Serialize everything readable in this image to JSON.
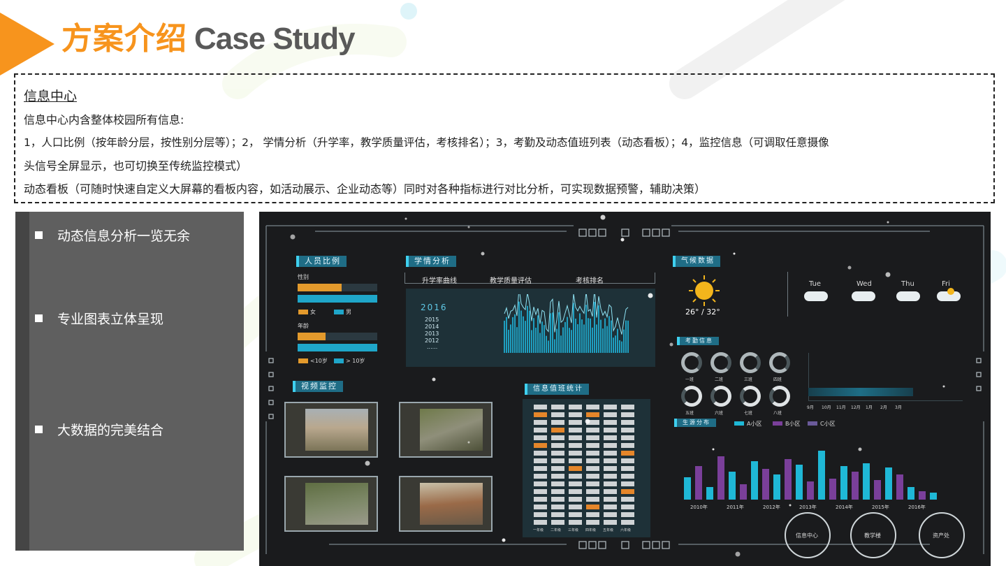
{
  "title": {
    "cn": "方案介绍",
    "en": "Case Study"
  },
  "info": {
    "heading": "信息中心",
    "line1": "信息中心内含整体校园所有信息:",
    "line2": "1，人口比例（按年龄分层，按性别分层等）；2， 学情分析（升学率，教学质量评估，考核排名）；3，考勤及动态值班列表（动态看板）；4，监控信息（可调取任意摄像",
    "line3": "头信号全屏显示，也可切换至传统监控模式）",
    "line4": "动态看板（可随时快速自定义大屏幕的看板内容，如活动展示、企业动态等）同时对各种指标进行对比分析，可实现数据预警，辅助决策）"
  },
  "features": [
    "动态信息分析一览无余",
    "专业图表立体呈现",
    "大数据的完美结合"
  ],
  "dashboard": {
    "people": {
      "title": "人员比例",
      "gender_label": "性别",
      "female": "女",
      "male": "男",
      "age_label": "年龄",
      "young": "<10岁",
      "old": "> 10岁"
    },
    "study": {
      "title": "学情分析",
      "tabs": [
        "升学率曲线",
        "教学质量评估",
        "考核排名"
      ],
      "current_year": "2016",
      "years": [
        "2015",
        "2014",
        "2013",
        "2012",
        "......"
      ]
    },
    "video": {
      "title": "视频监控"
    },
    "duty": {
      "title": "信息值班统计",
      "columns": [
        "一年级",
        "二年级",
        "三年级",
        "四年级",
        "五年级",
        "六年级"
      ]
    },
    "weather": {
      "title": "气候数据",
      "temp": "26° / 32°",
      "days": [
        "Tue",
        "Wed",
        "Thu",
        "Fri"
      ]
    },
    "attendance": {
      "title": "考勤信息",
      "classes_top": [
        "一班",
        "二班",
        "三班",
        "四班"
      ],
      "classes_bottom": [
        "五班",
        "六班",
        "七班",
        "八班"
      ],
      "months": [
        "9月",
        "10月",
        "11月",
        "12月",
        "1月",
        "2月",
        "3月"
      ]
    },
    "students": {
      "title": "生源分布",
      "legend": [
        "A小区",
        "B小区",
        "C小区"
      ],
      "years": [
        "2010年",
        "2011年",
        "2012年",
        "2013年",
        "2014年",
        "2015年",
        "2016年"
      ]
    },
    "nav": [
      "信息中心",
      "教学楼",
      "资产处"
    ]
  },
  "colors": {
    "accent": "#f7941d",
    "title_gray": "#595959",
    "cyan": "#1fb8d6",
    "purple": "#7a3f9a"
  }
}
